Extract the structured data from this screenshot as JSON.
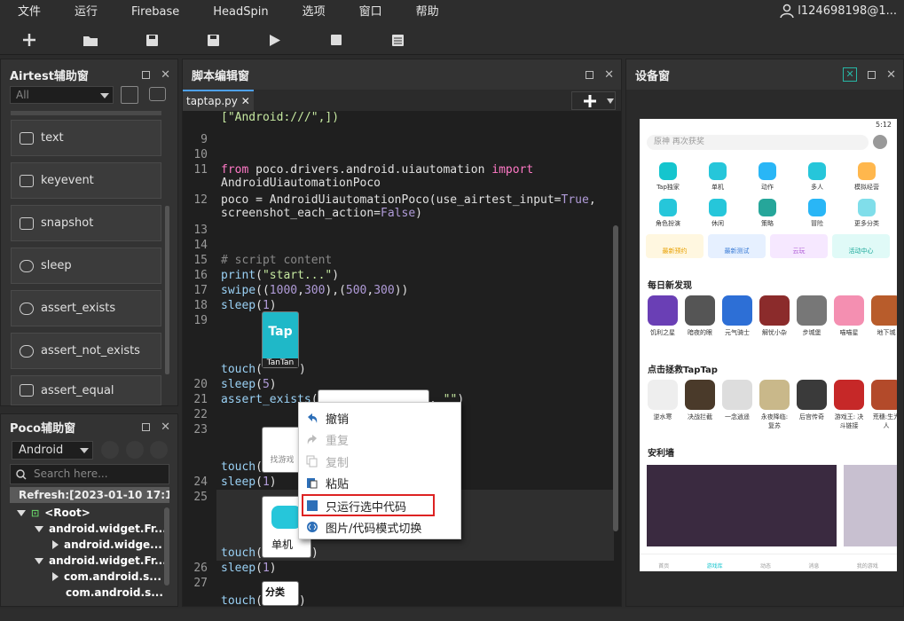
{
  "menu": [
    "文件",
    "运行",
    "Firebase",
    "HeadSpin",
    "选项",
    "窗口",
    "帮助"
  ],
  "user": "l124698198@1...",
  "toolbar": [
    "add-icon",
    "open-folder-icon",
    "save-icon",
    "save-as-icon",
    "play-icon",
    "stop-icon",
    "log-icon"
  ],
  "airtest": {
    "title": "Airtest辅助窗",
    "filter": "All",
    "buttons": [
      "text",
      "keyevent",
      "snapshot",
      "sleep",
      "assert_exists",
      "assert_not_exists",
      "assert_equal"
    ]
  },
  "poco": {
    "title": "Poco辅助窗",
    "mode": "Android",
    "search_placeholder": "Search here...",
    "refresh": "Refresh:[2023-01-10 17:12:",
    "tree": [
      "<Root>",
      "android.widget.Fr...",
      "android.widge...",
      "android.widget.Fr...",
      "com.android.s...",
      "com.android.s..."
    ]
  },
  "editor": {
    "title": "脚本编辑窗",
    "tab": "taptap.py",
    "lines": {
      "l1": "[\"Android:///\",])",
      "l10": "10",
      "l11": "11",
      "l12": "12",
      "l13": "13",
      "l14": "14",
      "l15": "15",
      "l16": "16",
      "l17": "17",
      "l18": "18",
      "l19": "19",
      "l20": "20",
      "l21": "21",
      "l22": "22",
      "l23": "23",
      "l24": "24",
      "l25": "25",
      "l26": "26",
      "l27": "27",
      "l9": "9"
    },
    "thumbs": {
      "tap": "Tap",
      "tap_sub": "TanTan",
      "find": "找游戏",
      "single": "单机",
      "cat": "分类"
    }
  },
  "context_menu": [
    "撤销",
    "重复",
    "复制",
    "粘贴",
    "只运行选中代码",
    "图片/代码模式切换"
  ],
  "device": {
    "title": "设备窗",
    "time": "5:12",
    "search": "原神 再次获奖",
    "grid": [
      "Tap独家",
      "单机",
      "动作",
      "多人",
      "模拟经营",
      "角色扮演",
      "休闲",
      "策略",
      "冒险",
      "更多分类"
    ],
    "cats": [
      "最新预约",
      "最新测试",
      "云玩",
      "活动中心"
    ],
    "sec1": "每日新发现",
    "sec1_apps": [
      "饥利之星",
      "暗夜的眼",
      "元气骑士",
      "解忧小杂",
      "步城堡",
      "喵喵星",
      "地下城"
    ],
    "sec2": "点击拯救TapTap",
    "sec2_apps": [
      "逆水寒",
      "决战拦截",
      "一念逍遥",
      "永夜降临: 复苏",
      "后宫传奇",
      "游戏王: 决斗链接",
      "荒穗:生为人"
    ],
    "sec3": "安利墙",
    "bottom": [
      "首页",
      "游戏库",
      "动态",
      "消息",
      "我的游戏"
    ]
  },
  "colors": {
    "accent": "#4ea1f3",
    "highlight_border": "#dd2222"
  }
}
